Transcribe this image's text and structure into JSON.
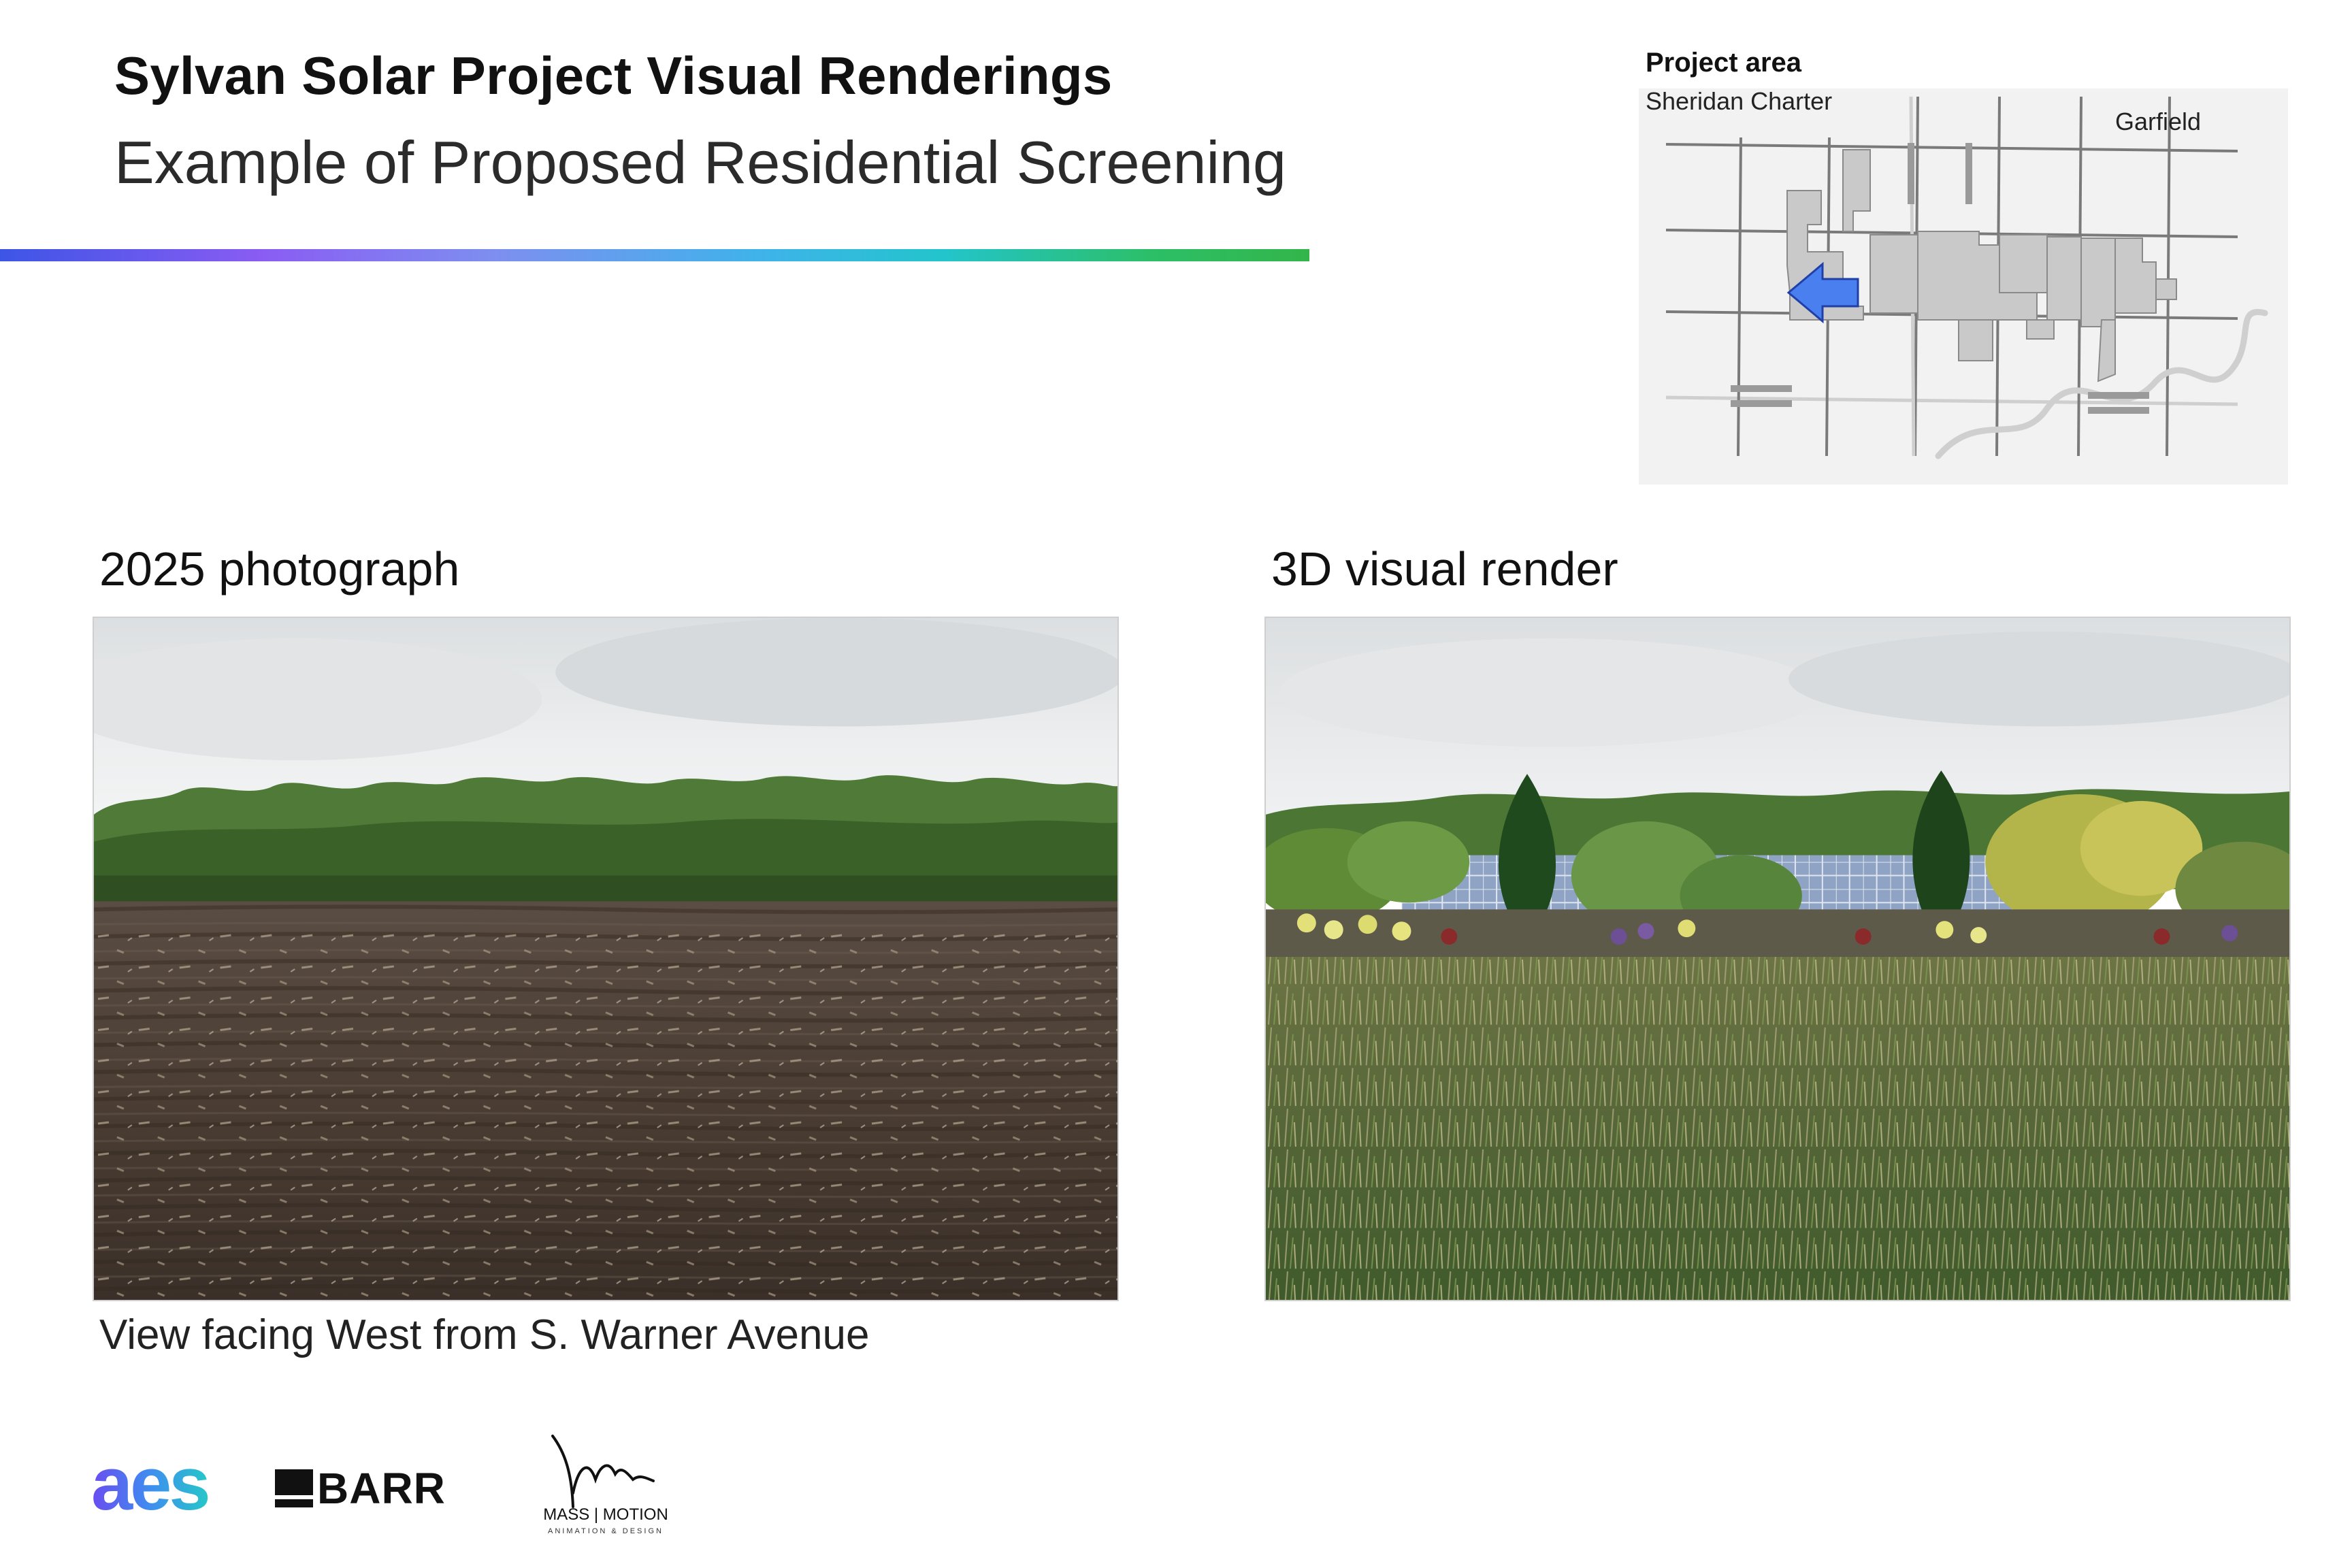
{
  "header": {
    "title": "Sylvan Solar Project Visual Renderings",
    "subtitle": "Example of Proposed Residential Screening"
  },
  "project_map": {
    "heading": "Project area",
    "labels": {
      "sheridan": "Sheridan Charter",
      "garfield": "Garfield"
    },
    "icons": [
      "location-arrow-icon"
    ]
  },
  "photo_section": {
    "heading": "2025 photograph",
    "caption": "View facing West from S. Warner Avenue"
  },
  "render_section": {
    "heading": "3D visual render"
  },
  "logos": {
    "aes": "aes",
    "barr": "BARR",
    "mass_name": "MASS | MOTION",
    "mass_sub": "ANIMATION & DESIGN"
  },
  "colors": {
    "accent_gradient": [
      "#3d55e6",
      "#8a5cf3",
      "#3fb3ea",
      "#33b54a"
    ],
    "arrow": "#4a7ff0"
  }
}
